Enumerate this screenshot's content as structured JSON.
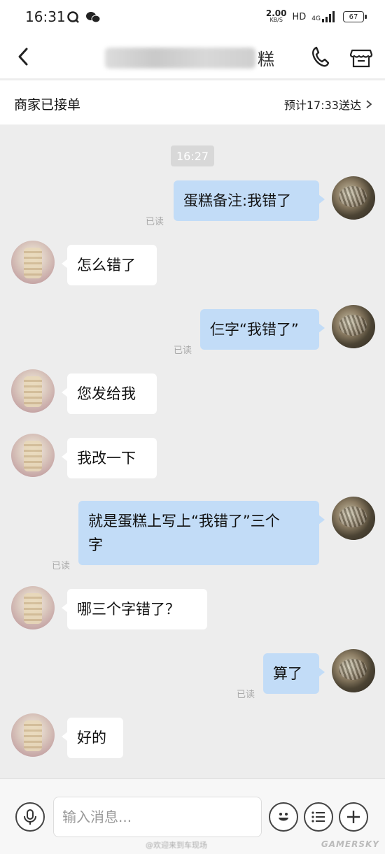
{
  "status_bar": {
    "time": "16:31",
    "net_speed": "2.00",
    "net_unit": "KB/S",
    "hd": "HD",
    "network": "4G",
    "battery": "67"
  },
  "header": {
    "title_visible": "糕",
    "title_obscured": true
  },
  "order": {
    "status": "商家已接单",
    "eta": "预计17:33送达"
  },
  "chat": {
    "timestamp": "16:27",
    "read_label": "已读",
    "messages": [
      {
        "sender": "me",
        "text": "蛋糕备注:我错了",
        "read": "已读"
      },
      {
        "sender": "shop",
        "text": "怎么错了"
      },
      {
        "sender": "me",
        "text": "仨字“我错了”",
        "read": "已读"
      },
      {
        "sender": "shop",
        "text": "您发给我"
      },
      {
        "sender": "shop",
        "text": "我改一下"
      },
      {
        "sender": "me",
        "text_line1": "就是蛋糕上写上“我错了”三个",
        "text_line2": "字",
        "read": "已读"
      },
      {
        "sender": "shop",
        "text": "哪三个字错了？"
      },
      {
        "sender": "me",
        "text": "算了",
        "read": "已读"
      },
      {
        "sender": "shop",
        "text": "好的"
      }
    ]
  },
  "input": {
    "placeholder": "输入消息..."
  },
  "watermark": {
    "weibo": "@欢迎来到车现场",
    "brand": "GAMERSKY"
  },
  "colors": {
    "my_bubble": "#c2dcf7",
    "shop_bubble": "#ffffff",
    "background": "#ededed"
  }
}
